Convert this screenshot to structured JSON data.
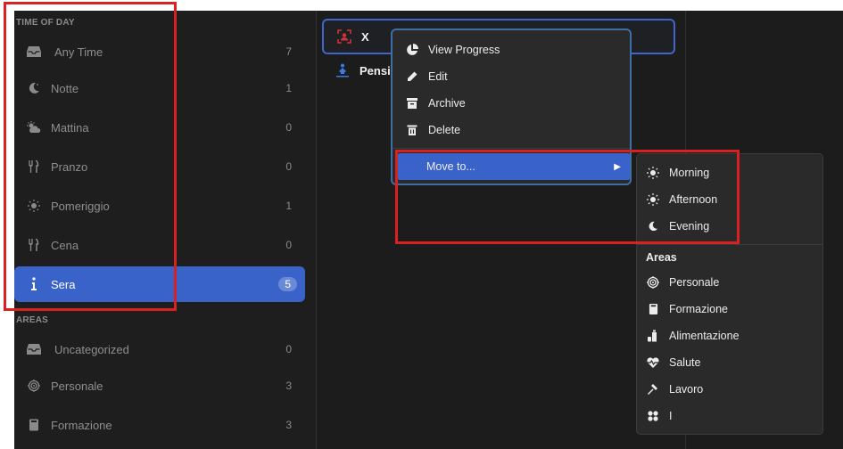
{
  "sidebar": {
    "time_of_day_label": "TIME OF DAY",
    "areas_label": "AREAS",
    "time_items": [
      {
        "label": "Any Time",
        "count": "7",
        "icon": "inbox-icon"
      },
      {
        "label": "Notte",
        "count": "1",
        "icon": "moon-icon"
      },
      {
        "label": "Mattina",
        "count": "0",
        "icon": "sun-cloud-icon"
      },
      {
        "label": "Pranzo",
        "count": "0",
        "icon": "utensils-icon"
      },
      {
        "label": "Pomeriggio",
        "count": "1",
        "icon": "sun-icon"
      },
      {
        "label": "Cena",
        "count": "0",
        "icon": "utensils-icon"
      },
      {
        "label": "Sera",
        "count": "5",
        "icon": "info-icon",
        "active": true
      }
    ],
    "area_items": [
      {
        "label": "Uncategorized",
        "count": "0",
        "icon": "inbox-icon"
      },
      {
        "label": "Personale",
        "count": "3",
        "icon": "target-icon"
      },
      {
        "label": "Formazione",
        "count": "3",
        "icon": "book-icon"
      }
    ]
  },
  "main": {
    "habits": [
      {
        "label": "X",
        "icon": "user-scan-icon",
        "selected": true
      },
      {
        "label": "Pensi",
        "icon": "meditation-icon"
      }
    ]
  },
  "context_menu": {
    "items": [
      {
        "label": "View Progress",
        "icon": "pie-chart-icon"
      },
      {
        "label": "Edit",
        "icon": "pencil-icon"
      },
      {
        "label": "Archive",
        "icon": "archive-icon"
      },
      {
        "label": "Delete",
        "icon": "trash-icon"
      }
    ],
    "move_to": {
      "label": "Move to...",
      "icon": "chevron-right-icon"
    }
  },
  "submenu": {
    "time_items": [
      {
        "label": "Morning",
        "icon": "sun-icon"
      },
      {
        "label": "Afternoon",
        "icon": "sun-icon"
      },
      {
        "label": "Evening",
        "icon": "moon-icon"
      }
    ],
    "areas_header": "Areas",
    "area_items": [
      {
        "label": "Personale",
        "icon": "target-icon"
      },
      {
        "label": "Formazione",
        "icon": "book-icon"
      },
      {
        "label": "Alimentazione",
        "icon": "bottle-icon"
      },
      {
        "label": "Salute",
        "icon": "heart-pulse-icon"
      },
      {
        "label": "Lavoro",
        "icon": "hammer-icon"
      },
      {
        "label": "I",
        "icon": "clover-icon"
      }
    ]
  },
  "colors": {
    "accent": "#3a63c9",
    "annotation_red": "#d92121",
    "background": "#1e1e1e"
  }
}
